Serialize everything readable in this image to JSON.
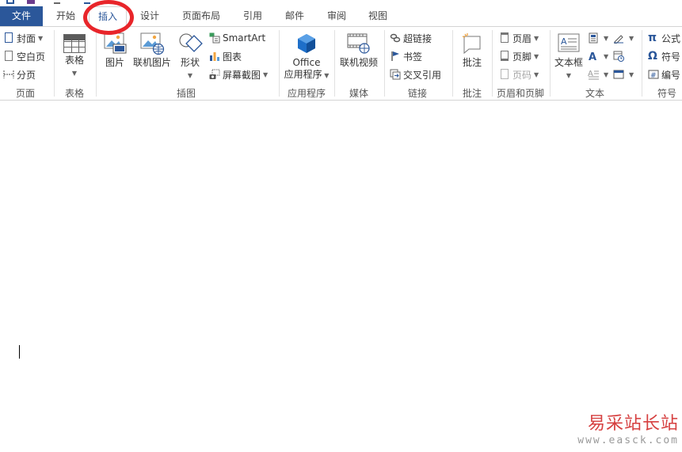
{
  "tabs": [
    "文件",
    "开始",
    "插入",
    "设计",
    "页面布局",
    "引用",
    "邮件",
    "审阅",
    "视图"
  ],
  "active_tab": "插入",
  "groups": {
    "pages": {
      "label": "页面",
      "cover": "封面",
      "blank": "空白页",
      "break": "分页"
    },
    "tables": {
      "label": "表格",
      "table": "表格"
    },
    "illustrations": {
      "label": "插图",
      "pictures": "图片",
      "online_pictures": "联机图片",
      "shapes": "形状",
      "smartart": "SmartArt",
      "chart": "图表",
      "screenshot": "屏幕截图"
    },
    "apps": {
      "label": "应用程序",
      "office_line1": "Office",
      "office_line2": "应用程序"
    },
    "media": {
      "label": "媒体",
      "online_video": "联机视频"
    },
    "links": {
      "label": "链接",
      "hyperlink": "超链接",
      "bookmark": "书签",
      "cross_ref": "交叉引用"
    },
    "comments": {
      "label": "批注",
      "comment": "批注"
    },
    "header_footer": {
      "label": "页眉和页脚",
      "header": "页眉",
      "footer": "页脚",
      "page_number": "页码"
    },
    "text": {
      "label": "文本",
      "textbox": "文本框"
    },
    "symbols": {
      "label": "符号",
      "equation": "公式",
      "symbol": "符号",
      "number": "编号"
    }
  },
  "watermark": {
    "line1": "易采站长站",
    "line2": "www.easck.com"
  },
  "colors": {
    "file_tab": "#2b579a",
    "accent": "#2b579a",
    "annotation_circle": "#e8252a",
    "watermark_red": "#d64040"
  }
}
